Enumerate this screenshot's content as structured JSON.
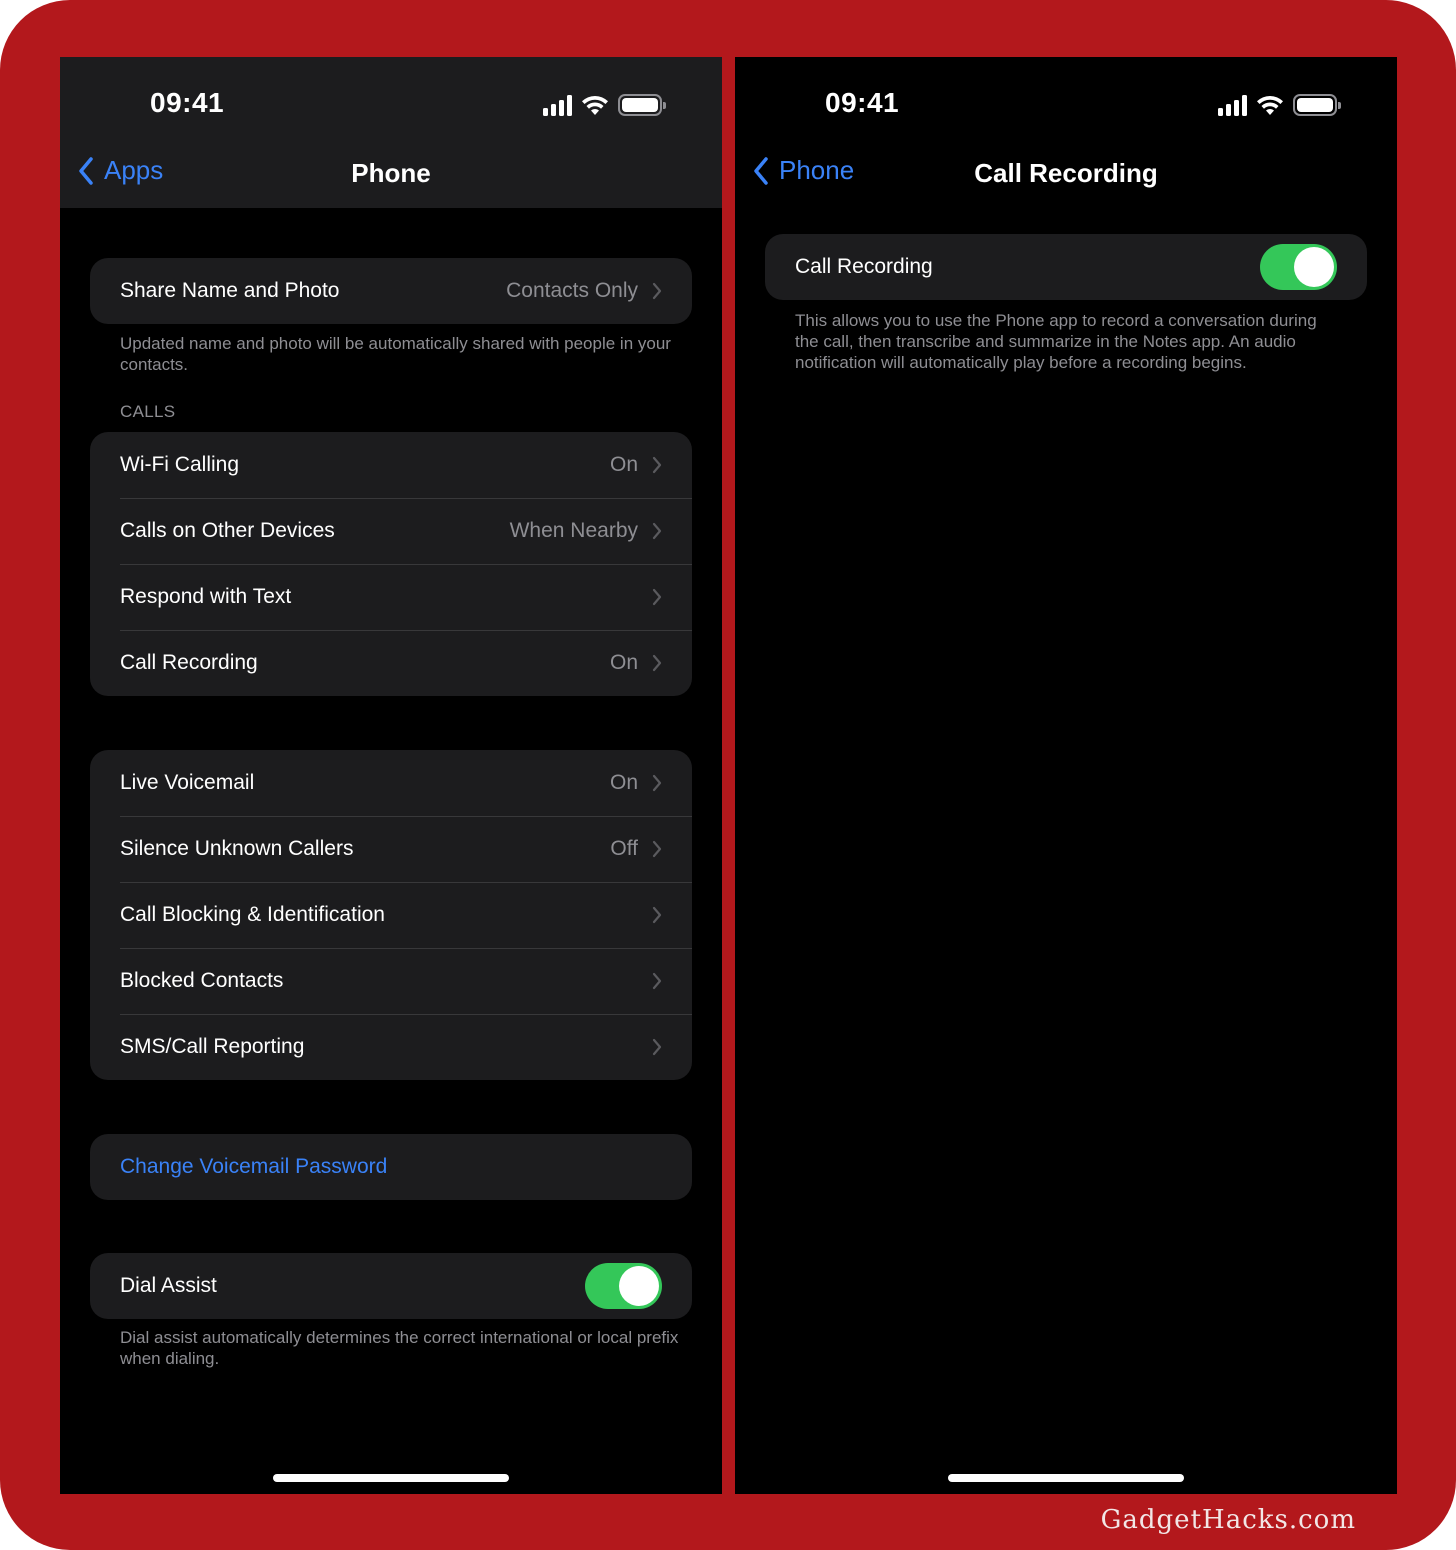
{
  "brand": {
    "frame_color": "#b3181c",
    "accent_blue": "#3a82f7",
    "toggle_green": "#34c759",
    "watermark": "GadgetHacks.com"
  },
  "left_screen": {
    "status": {
      "time": "09:41",
      "icons": [
        "cellular-signal-icon",
        "wifi-icon",
        "battery-icon"
      ]
    },
    "nav": {
      "back_label": "Apps",
      "title": "Phone"
    },
    "share_group": {
      "rows": [
        {
          "label": "Share Name and Photo",
          "value": "Contacts Only"
        }
      ],
      "footnote": "Updated name and photo will be automatically shared with people in your contacts."
    },
    "calls_group": {
      "header": "CALLS",
      "rows": [
        {
          "label": "Wi-Fi Calling",
          "value": "On"
        },
        {
          "label": "Calls on Other Devices",
          "value": "When Nearby"
        },
        {
          "label": "Respond with Text",
          "value": ""
        },
        {
          "label": "Call Recording",
          "value": "On"
        }
      ]
    },
    "voicemail_group": {
      "rows": [
        {
          "label": "Live Voicemail",
          "value": "On"
        },
        {
          "label": "Silence Unknown Callers",
          "value": "Off"
        },
        {
          "label": "Call Blocking & Identification",
          "value": ""
        },
        {
          "label": "Blocked Contacts",
          "value": ""
        },
        {
          "label": "SMS/Call Reporting",
          "value": ""
        }
      ]
    },
    "password_group": {
      "link_label": "Change Voicemail Password"
    },
    "dial_assist": {
      "label": "Dial Assist",
      "enabled": true,
      "footnote": "Dial assist automatically determines the correct international or local prefix when dialing."
    }
  },
  "right_screen": {
    "status": {
      "time": "09:41",
      "icons": [
        "cellular-signal-icon",
        "wifi-icon",
        "battery-icon"
      ]
    },
    "nav": {
      "back_label": "Phone",
      "title": "Call Recording"
    },
    "call_recording": {
      "label": "Call Recording",
      "enabled": true,
      "footnote": "This allows you to use the Phone app to record a conversation during the call, then transcribe and summarize in the Notes app. An audio notification will automatically play before a recording begins."
    }
  }
}
